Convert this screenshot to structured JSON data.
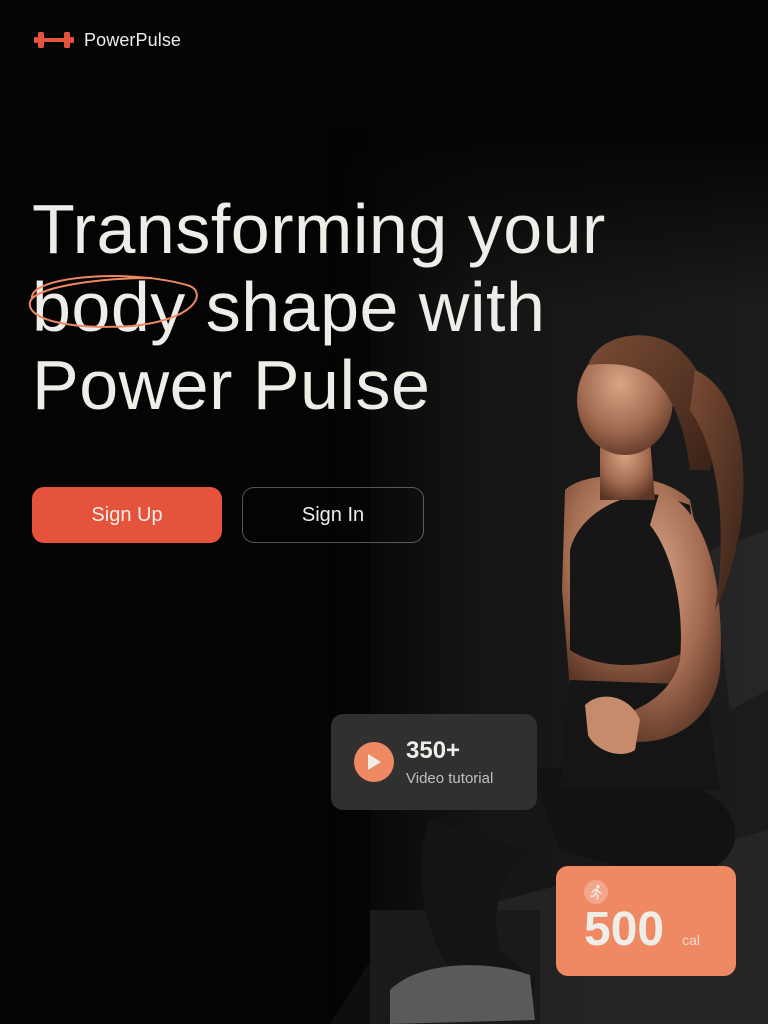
{
  "brand": {
    "name": "PowerPulse",
    "icon": "dumbbell-icon",
    "accent": "#E6533C"
  },
  "hero": {
    "line1": "Transforming your",
    "highlight_word": "body",
    "line2_rest": "shape with",
    "line3": "Power Pulse"
  },
  "actions": {
    "signup_label": "Sign Up",
    "signin_label": "Sign In"
  },
  "stats": {
    "video": {
      "count": "350+",
      "label": "Video tutorial",
      "icon": "play-icon"
    },
    "calories": {
      "value": "500",
      "unit": "cal",
      "icon": "running-icon"
    }
  },
  "colors": {
    "background": "#040404",
    "text": "#EFEDE8",
    "orange": "#E6533C",
    "peach": "#EF8964",
    "card": "#303030"
  }
}
